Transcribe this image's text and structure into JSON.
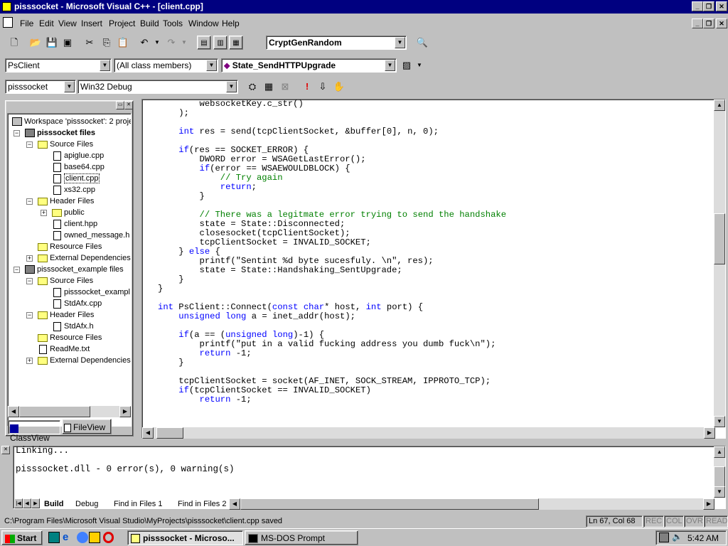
{
  "window": {
    "title": "pisssocket - Microsoft Visual C++ - [client.cpp]"
  },
  "menu": [
    "File",
    "Edit",
    "View",
    "Insert",
    "Project",
    "Build",
    "Tools",
    "Window",
    "Help"
  ],
  "toolbar": {
    "find_combo": "CryptGenRandom",
    "class_combo": "PsClient",
    "members_combo": "(All class members)",
    "function_combo": "State_SendHTTPUpgrade",
    "project_combo": "pisssocket",
    "config_combo": "Win32 Debug"
  },
  "workspace": {
    "root": "Workspace 'pisssocket': 2 proje",
    "items": [
      "pisssocket files",
      "Source Files",
      "apiglue.cpp",
      "base64.cpp",
      "client.cpp",
      "xs32.cpp",
      "Header Files",
      "public",
      "client.hpp",
      "owned_message.h",
      "Resource Files",
      "External Dependencies",
      "pisssocket_example files",
      "Source Files",
      "pisssocket_exampl",
      "StdAfx.cpp",
      "Header Files",
      "StdAfx.h",
      "Resource Files",
      "ReadMe.txt",
      "External Dependencies"
    ],
    "tabs": [
      "ClassView",
      "FileView"
    ]
  },
  "editor": {
    "lines": [
      "        websocketKey.c_str()",
      "    );",
      "",
      "    int res = send(tcpClientSocket, &buffer[0], n, 0);",
      "",
      "    if(res == SOCKET_ERROR) {",
      "        DWORD error = WSAGetLastError();",
      "        if(error == WSAEWOULDBLOCK) {",
      "            // Try again",
      "            return;",
      "        }",
      "",
      "        // There was a legitmate error trying to send the handshake",
      "        state = State::Disconnected;",
      "        closesocket(tcpClientSocket);",
      "        tcpClientSocket = INVALID_SOCKET;",
      "    } else {",
      "        printf(\"Sentint %d byte sucesfuly. \\n\", res);",
      "        state = State::Handshaking_SentUpgrade;",
      "    }",
      "}",
      "",
      "int PsClient::Connect(const char* host, int port) {",
      "    unsigned long a = inet_addr(host);",
      "",
      "    if(a == (unsigned long)-1) {",
      "        printf(\"put in a valid fucking address you dumb fuck\\n\");",
      "        return -1;",
      "    }",
      "",
      "    tcpClientSocket = socket(AF_INET, SOCK_STREAM, IPPROTO_TCP);",
      "    if(tcpClientSocket == INVALID_SOCKET)",
      "        return -1;"
    ]
  },
  "output": {
    "lines": [
      "Linking...",
      "",
      "pisssocket.dll - 0 error(s), 0 warning(s)"
    ],
    "tabs": [
      "Build",
      "Debug",
      "Find in Files 1",
      "Find in Files 2"
    ]
  },
  "statusbar": {
    "message": "C:\\Program Files\\Microsoft Visual Studio\\MyProjects\\pisssocket\\client.cpp saved",
    "position": "Ln 67, Col 68",
    "indicators": [
      "REC",
      "COL",
      "OVR",
      "READ"
    ]
  },
  "taskbar": {
    "start": "Start",
    "tasks": [
      "pisssocket - Microso...",
      "MS-DOS Prompt"
    ],
    "clock": "5:42 AM"
  },
  "colors": {
    "titlebar": "#000080",
    "keyword": "#0000ff",
    "comment": "#008000"
  }
}
